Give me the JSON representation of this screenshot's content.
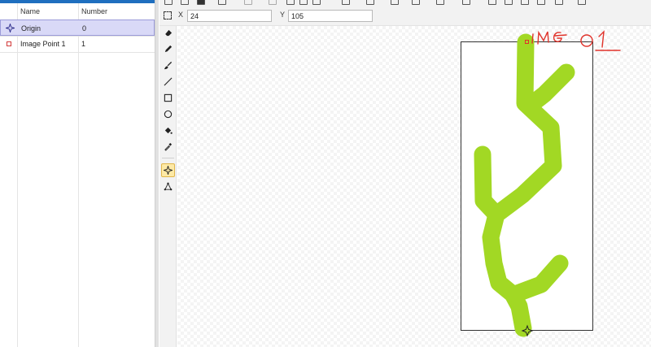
{
  "point_list": {
    "columns": {
      "name": "Name",
      "number": "Number"
    },
    "rows": [
      {
        "icon": "origin-marker-icon",
        "name": "Origin",
        "number": "0",
        "selected": true
      },
      {
        "icon": "image-point-square-icon",
        "name": "Image Point 1",
        "number": "1",
        "selected": false
      }
    ]
  },
  "coordinates": {
    "x_label": "X",
    "x_value": "24",
    "y_label": "Y",
    "y_value": "105"
  },
  "tools": [
    {
      "name": "eraser-icon",
      "active": false
    },
    {
      "name": "pencil-icon",
      "active": false
    },
    {
      "name": "brush-icon",
      "active": false
    },
    {
      "name": "line-icon",
      "active": false
    },
    {
      "name": "rectangle-icon",
      "active": false
    },
    {
      "name": "ellipse-icon",
      "active": false
    },
    {
      "name": "fill-bucket-icon",
      "active": false
    },
    {
      "name": "eyedropper-icon",
      "active": false
    },
    {
      "name": "point-marker-icon",
      "active": true
    },
    {
      "name": "triangle-points-icon",
      "active": false
    }
  ],
  "image": {
    "shape_color": "#a2d824",
    "annotation_text": "IMG 01",
    "annotation_color": "#e0322a"
  },
  "colors": {
    "accent": "#1f6fbf",
    "selection": "#d9d9f7",
    "active_tool": "#fde9a6"
  }
}
